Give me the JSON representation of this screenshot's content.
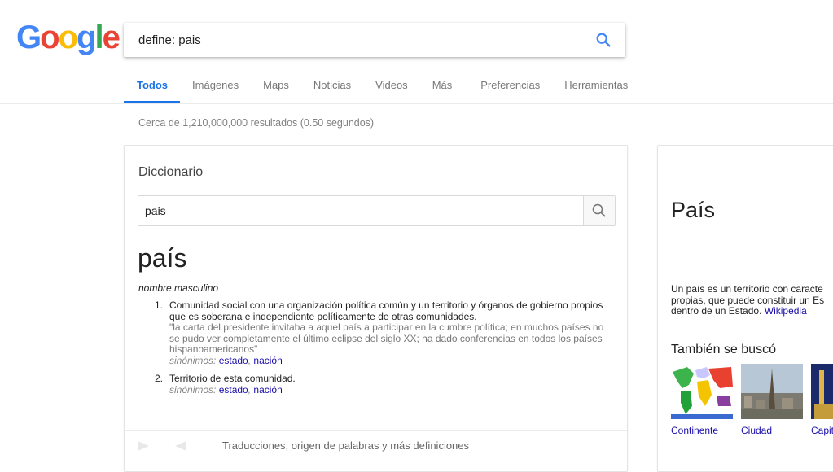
{
  "logo": [
    "G",
    "o",
    "o",
    "g",
    "l",
    "e"
  ],
  "search": {
    "value": "define: pais"
  },
  "tabs": [
    "Todos",
    "Imágenes",
    "Maps",
    "Noticias",
    "Videos",
    "Más",
    "Preferencias",
    "Herramientas"
  ],
  "stats": "Cerca de 1,210,000,000 resultados (0.50 segundos)",
  "dictionary": {
    "title": "Diccionario",
    "search_value": "pais",
    "word": "país",
    "part_of_speech": "nombre masculino",
    "definitions": [
      {
        "num": "1.",
        "text": "Comunidad social con una organización política común y un territorio y órganos de gobierno propios que es soberana e independiente políticamente de otras comunidades.",
        "example": "\"la carta del presidente invitaba a aquel país a participar en la cumbre política; en muchos países no se pudo ver completamente el último eclipse del siglo XX; ha dado conferencias en todos los países hispanoamericanos\"",
        "syn_label": "sinónimos:",
        "syn1": "estado",
        "syn_sep": ",",
        "syn2": "nación"
      },
      {
        "num": "2.",
        "text": "Territorio de esta comunidad.",
        "syn_label": "sinónimos:",
        "syn1": "estado",
        "syn_sep": ",",
        "syn2": "nación"
      }
    ],
    "more": "Traducciones, origen de palabras y más definiciones"
  },
  "knowledge_panel": {
    "title": "País",
    "desc_line1": "Un país  es un territorio con caracte",
    "desc_line2": "propias, que puede constituir un Es",
    "desc_line3": "dentro de un Estado. ",
    "source": "Wikipedia",
    "also_searched": "También se buscó",
    "thumbs": [
      "Continente",
      "Ciudad",
      "Capit"
    ]
  }
}
